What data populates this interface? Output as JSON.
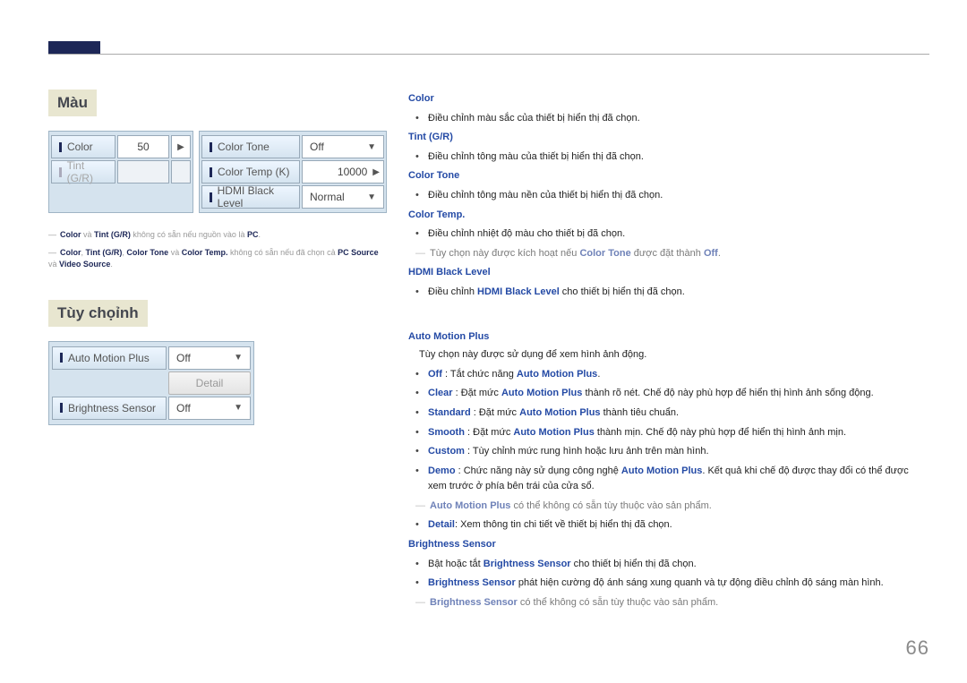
{
  "page_number": "66",
  "left": {
    "section1": {
      "title": "Màu",
      "panelA": {
        "rows": [
          {
            "label": "Color",
            "value": "50",
            "arrow": "▶",
            "disabled": false
          },
          {
            "label": "Tint (G/R)",
            "value": "",
            "arrow": "",
            "disabled": true
          }
        ]
      },
      "panelB": {
        "rows": [
          {
            "label": "Color Tone",
            "value": "Off",
            "arrow": "▼"
          },
          {
            "label": "Color Temp (K)",
            "value": "10000",
            "arrow": "▶"
          },
          {
            "label": "HDMI Black Level",
            "value": "Normal",
            "arrow": "▼"
          }
        ]
      },
      "footnotes": [
        {
          "prefix": "―",
          "parts": [
            {
              "t": "Color",
              "b": true
            },
            {
              "t": " và "
            },
            {
              "t": "Tint (G/R)",
              "b": true
            },
            {
              "t": " không có sẵn nếu nguồn vào là "
            },
            {
              "t": "PC",
              "b": true
            },
            {
              "t": "."
            }
          ]
        },
        {
          "prefix": "―",
          "parts": [
            {
              "t": "Color",
              "b": true
            },
            {
              "t": ", "
            },
            {
              "t": "Tint (G/R)",
              "b": true
            },
            {
              "t": ", "
            },
            {
              "t": "Color Tone",
              "b": true
            },
            {
              "t": " và "
            },
            {
              "t": "Color Temp.",
              "b": true
            },
            {
              "t": " không có sẵn nếu đã chọn cả "
            },
            {
              "t": "PC Source",
              "b": true
            },
            {
              "t": " và "
            },
            {
              "t": "Video Source",
              "b": true
            },
            {
              "t": "."
            }
          ]
        }
      ]
    },
    "section2": {
      "title": "Tùy chọỉnh",
      "panel": {
        "rows": [
          {
            "label": "Auto Motion Plus",
            "value": "Off",
            "arrow": "▼",
            "type": "select"
          },
          {
            "label": "",
            "value": "Detail",
            "arrow": "",
            "type": "button"
          },
          {
            "label": "Brightness Sensor",
            "value": "Off",
            "arrow": "▼",
            "type": "select"
          }
        ]
      }
    }
  },
  "right": {
    "items": [
      {
        "type": "h",
        "text": "Color"
      },
      {
        "type": "li",
        "parts": [
          {
            "t": "Điều chỉnh màu sắc của thiết bị hiển thị đã chọn."
          }
        ]
      },
      {
        "type": "h",
        "text": "Tint (G/R)"
      },
      {
        "type": "li",
        "parts": [
          {
            "t": "Điều chỉnh tông màu của thiết bị hiển thị đã chọn."
          }
        ]
      },
      {
        "type": "h",
        "text": "Color Tone"
      },
      {
        "type": "li",
        "parts": [
          {
            "t": "Điều chỉnh tông màu nền của thiết bị hiển thị đã chọn."
          }
        ]
      },
      {
        "type": "h",
        "text": "Color Temp."
      },
      {
        "type": "li",
        "parts": [
          {
            "t": "Điều chỉnh nhiệt độ màu cho thiết bị đã chọn."
          }
        ]
      },
      {
        "type": "note",
        "parts": [
          {
            "t": "Tùy chọn này được kích hoạt nếu "
          },
          {
            "t": "Color Tone",
            "b": true
          },
          {
            "t": " được đặt thành "
          },
          {
            "t": "Off",
            "b": true
          },
          {
            "t": "."
          }
        ]
      },
      {
        "type": "h",
        "text": "HDMI Black Level"
      },
      {
        "type": "li",
        "parts": [
          {
            "t": "Điều chỉnh "
          },
          {
            "t": "HDMI Black Level",
            "b": true
          },
          {
            "t": " cho thiết bị hiển thị đã chọn."
          }
        ]
      },
      {
        "type": "spacer"
      },
      {
        "type": "h",
        "text": "Auto Motion Plus"
      },
      {
        "type": "p",
        "parts": [
          {
            "t": "Tùy chọn này được sử dụng để xem hình ảnh động."
          }
        ]
      },
      {
        "type": "li",
        "parts": [
          {
            "t": "Off",
            "b": true
          },
          {
            "t": " : Tắt chức năng "
          },
          {
            "t": "Auto Motion Plus",
            "b": true
          },
          {
            "t": "."
          }
        ]
      },
      {
        "type": "li",
        "parts": [
          {
            "t": "Clear",
            "b": true
          },
          {
            "t": " : Đặt mức "
          },
          {
            "t": "Auto Motion Plus",
            "b": true
          },
          {
            "t": " thành rõ nét. Chế độ này phù hợp để hiển thị hình ảnh sống động."
          }
        ]
      },
      {
        "type": "li",
        "parts": [
          {
            "t": "Standard",
            "b": true
          },
          {
            "t": " : Đặt mức "
          },
          {
            "t": "Auto Motion Plus",
            "b": true
          },
          {
            "t": " thành tiêu chuẩn."
          }
        ]
      },
      {
        "type": "li",
        "parts": [
          {
            "t": "Smooth",
            "b": true
          },
          {
            "t": " : Đặt mức "
          },
          {
            "t": "Auto Motion Plus",
            "b": true
          },
          {
            "t": " thành mịn. Chế độ này phù hợp để hiển thị hình ảnh mịn."
          }
        ]
      },
      {
        "type": "li",
        "parts": [
          {
            "t": "Custom",
            "b": true
          },
          {
            "t": " : Tùy chỉnh mức rung hình hoặc lưu ảnh trên màn hình."
          }
        ]
      },
      {
        "type": "li",
        "parts": [
          {
            "t": "Demo",
            "b": true
          },
          {
            "t": " : Chức năng này sử dụng công nghệ "
          },
          {
            "t": "Auto Motion Plus",
            "b": true
          },
          {
            "t": ". Kết quả khi chế độ được thay đổi có thể được xem trước ở phía bên trái của cửa sổ."
          }
        ]
      },
      {
        "type": "note",
        "parts": [
          {
            "t": "Auto Motion Plus",
            "b": true
          },
          {
            "t": " có thể không có sẵn tùy thuộc vào sản phẩm."
          }
        ]
      },
      {
        "type": "li",
        "parts": [
          {
            "t": "Detail",
            "b": true
          },
          {
            "t": ": Xem thông tin chi tiết về thiết bị hiển thị đã chọn."
          }
        ]
      },
      {
        "type": "h",
        "text": "Brightness Sensor"
      },
      {
        "type": "li",
        "parts": [
          {
            "t": "Bật hoặc tắt "
          },
          {
            "t": "Brightness Sensor",
            "b": true
          },
          {
            "t": " cho thiết bị hiển thị đã chọn."
          }
        ]
      },
      {
        "type": "li",
        "parts": [
          {
            "t": "Brightness Sensor",
            "b": true
          },
          {
            "t": " phát hiện cường độ ánh sáng xung quanh và tự động điều chỉnh độ sáng màn hình."
          }
        ]
      },
      {
        "type": "note",
        "parts": [
          {
            "t": "Brightness Sensor",
            "b": true
          },
          {
            "t": " có thể không có sẵn tùy thuộc vào sản phẩm."
          }
        ]
      }
    ]
  }
}
